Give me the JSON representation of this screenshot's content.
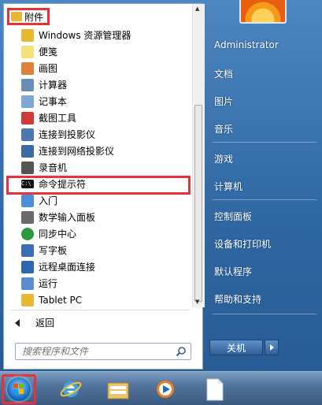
{
  "programs": {
    "folder_label": "附件",
    "items": [
      {
        "label": "Windows 资源管理器",
        "icon": "explorer-icon"
      },
      {
        "label": "便笺",
        "icon": "sticky-notes-icon"
      },
      {
        "label": "画图",
        "icon": "paint-icon"
      },
      {
        "label": "计算器",
        "icon": "calculator-icon"
      },
      {
        "label": "记事本",
        "icon": "notepad-icon"
      },
      {
        "label": "截图工具",
        "icon": "snipping-tool-icon"
      },
      {
        "label": "连接到投影仪",
        "icon": "projector-icon"
      },
      {
        "label": "连接到网络投影仪",
        "icon": "network-projector-icon"
      },
      {
        "label": "录音机",
        "icon": "microphone-icon"
      },
      {
        "label": "命令提示符",
        "icon": "cmd-icon"
      },
      {
        "label": "入门",
        "icon": "getting-started-icon"
      },
      {
        "label": "数学输入面板",
        "icon": "math-input-icon"
      },
      {
        "label": "同步中心",
        "icon": "sync-center-icon"
      },
      {
        "label": "写字板",
        "icon": "wordpad-icon"
      },
      {
        "label": "远程桌面连接",
        "icon": "remote-desktop-icon"
      },
      {
        "label": "运行",
        "icon": "run-icon"
      },
      {
        "label": "Tablet PC",
        "icon": "folder-icon"
      }
    ],
    "back_label": "返回"
  },
  "search": {
    "placeholder": "搜索程序和文件"
  },
  "right_pane": {
    "user_name": "Administrator",
    "items": [
      "文档",
      "图片",
      "音乐",
      "游戏",
      "计算机",
      "控制面板",
      "设备和打印机",
      "默认程序",
      "帮助和支持"
    ]
  },
  "shutdown": {
    "label": "关机"
  },
  "taskbar": {
    "pinned": [
      "internet-explorer-icon",
      "file-explorer-icon",
      "media-player-icon",
      "document-icon"
    ]
  },
  "colors": {
    "highlight_border": "#e8323a",
    "menu_blue": "#2f67a2"
  }
}
